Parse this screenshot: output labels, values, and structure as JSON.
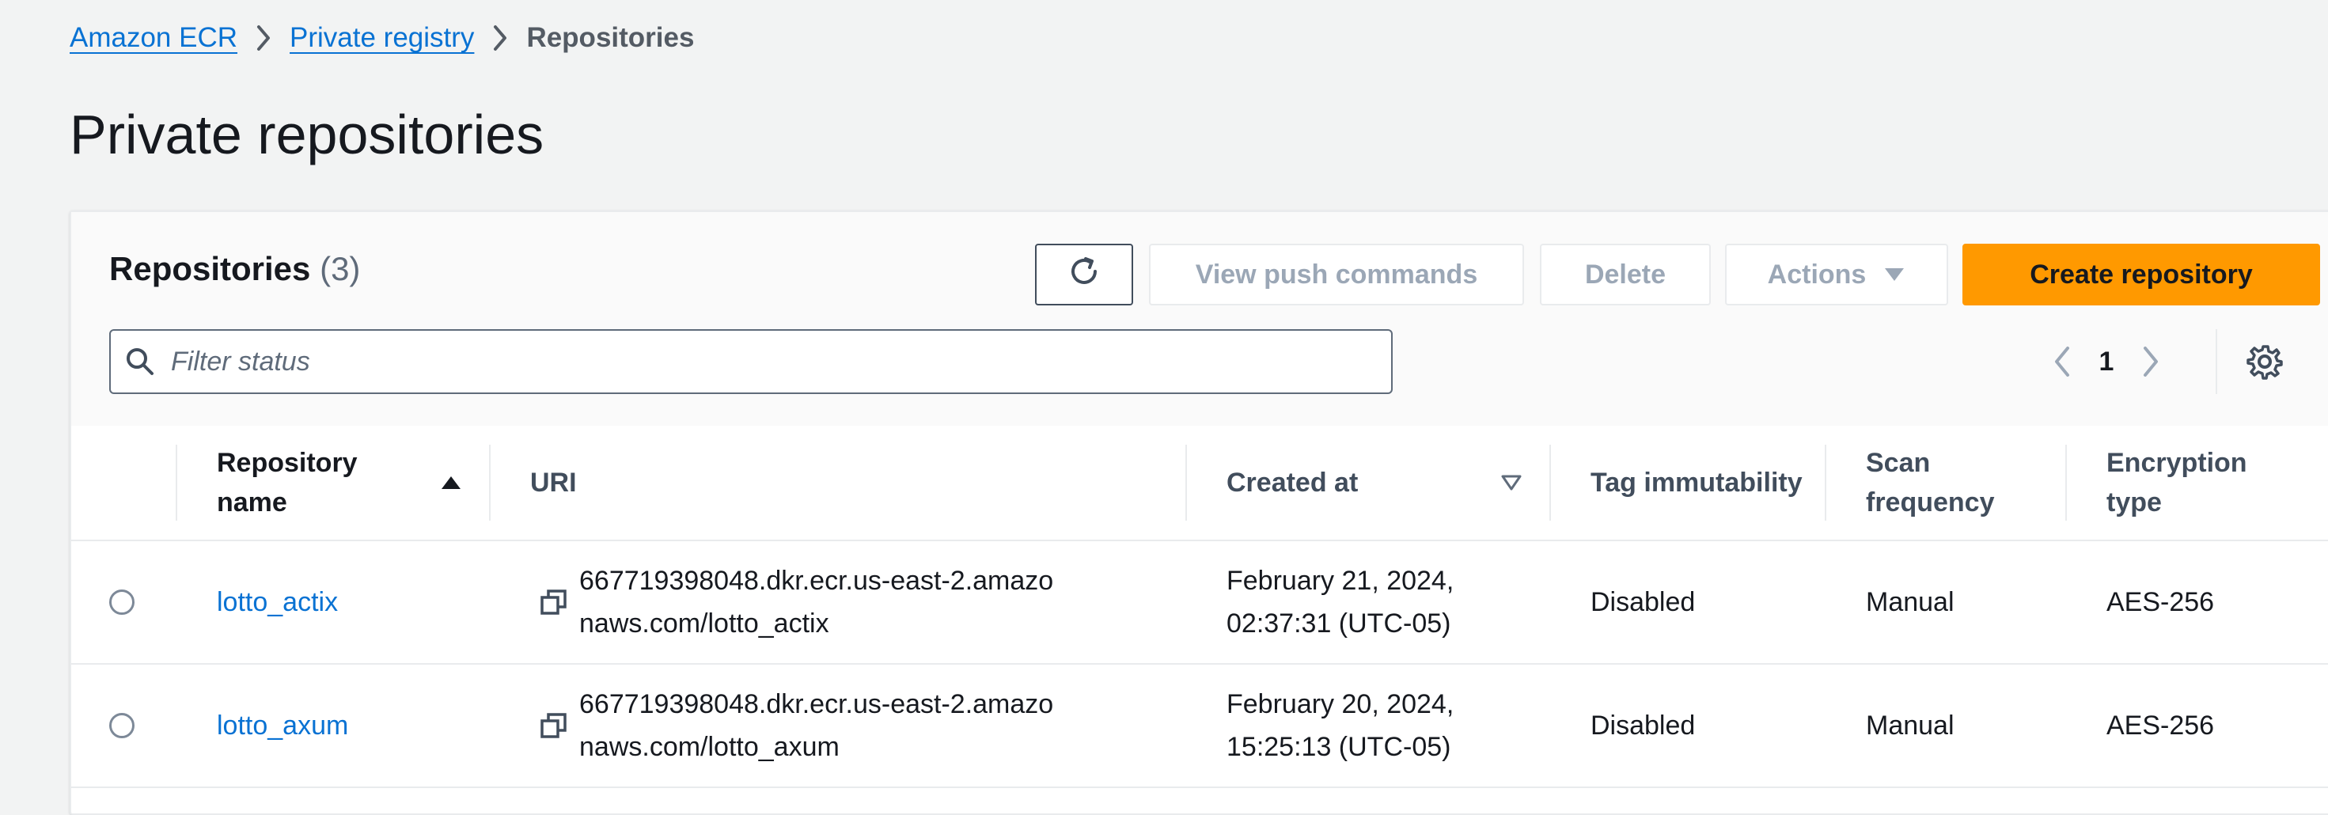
{
  "breadcrumb": {
    "items": [
      "Amazon ECR",
      "Private registry"
    ],
    "current": "Repositories"
  },
  "page_title": "Private repositories",
  "panel": {
    "title": "Repositories",
    "count": "(3)",
    "buttons": {
      "push_commands": "View push commands",
      "delete": "Delete",
      "actions": "Actions",
      "create": "Create repository"
    },
    "filter_placeholder": "Filter status",
    "page_number": "1"
  },
  "table": {
    "headers": {
      "name": "Repository name",
      "uri": "URI",
      "created": "Created at",
      "tag": "Tag immutability",
      "scan": "Scan frequency",
      "encryption": "Encryption type"
    },
    "rows": [
      {
        "name": "lotto_actix",
        "uri": "667719398048.dkr.ecr.us-east-2.amazonaws.com/lotto_actix",
        "created": "February 21, 2024, 02:37:31 (UTC-05)",
        "tag": "Disabled",
        "scan": "Manual",
        "encryption": "AES-256"
      },
      {
        "name": "lotto_axum",
        "uri": "667719398048.dkr.ecr.us-east-2.amazonaws.com/lotto_axum",
        "created": "February 20, 2024, 15:25:13 (UTC-05)",
        "tag": "Disabled",
        "scan": "Manual",
        "encryption": "AES-256"
      }
    ]
  },
  "colors": {
    "link": "#0972d3",
    "primary_button": "#ff9900",
    "background": "#f2f3f3"
  },
  "icons": [
    "chevron-right-icon",
    "refresh-icon",
    "caret-down-icon",
    "search-icon",
    "chevron-left-icon",
    "settings-gear-icon",
    "sort-ascending-icon",
    "sort-descending-icon",
    "copy-icon",
    "radio-button"
  ]
}
